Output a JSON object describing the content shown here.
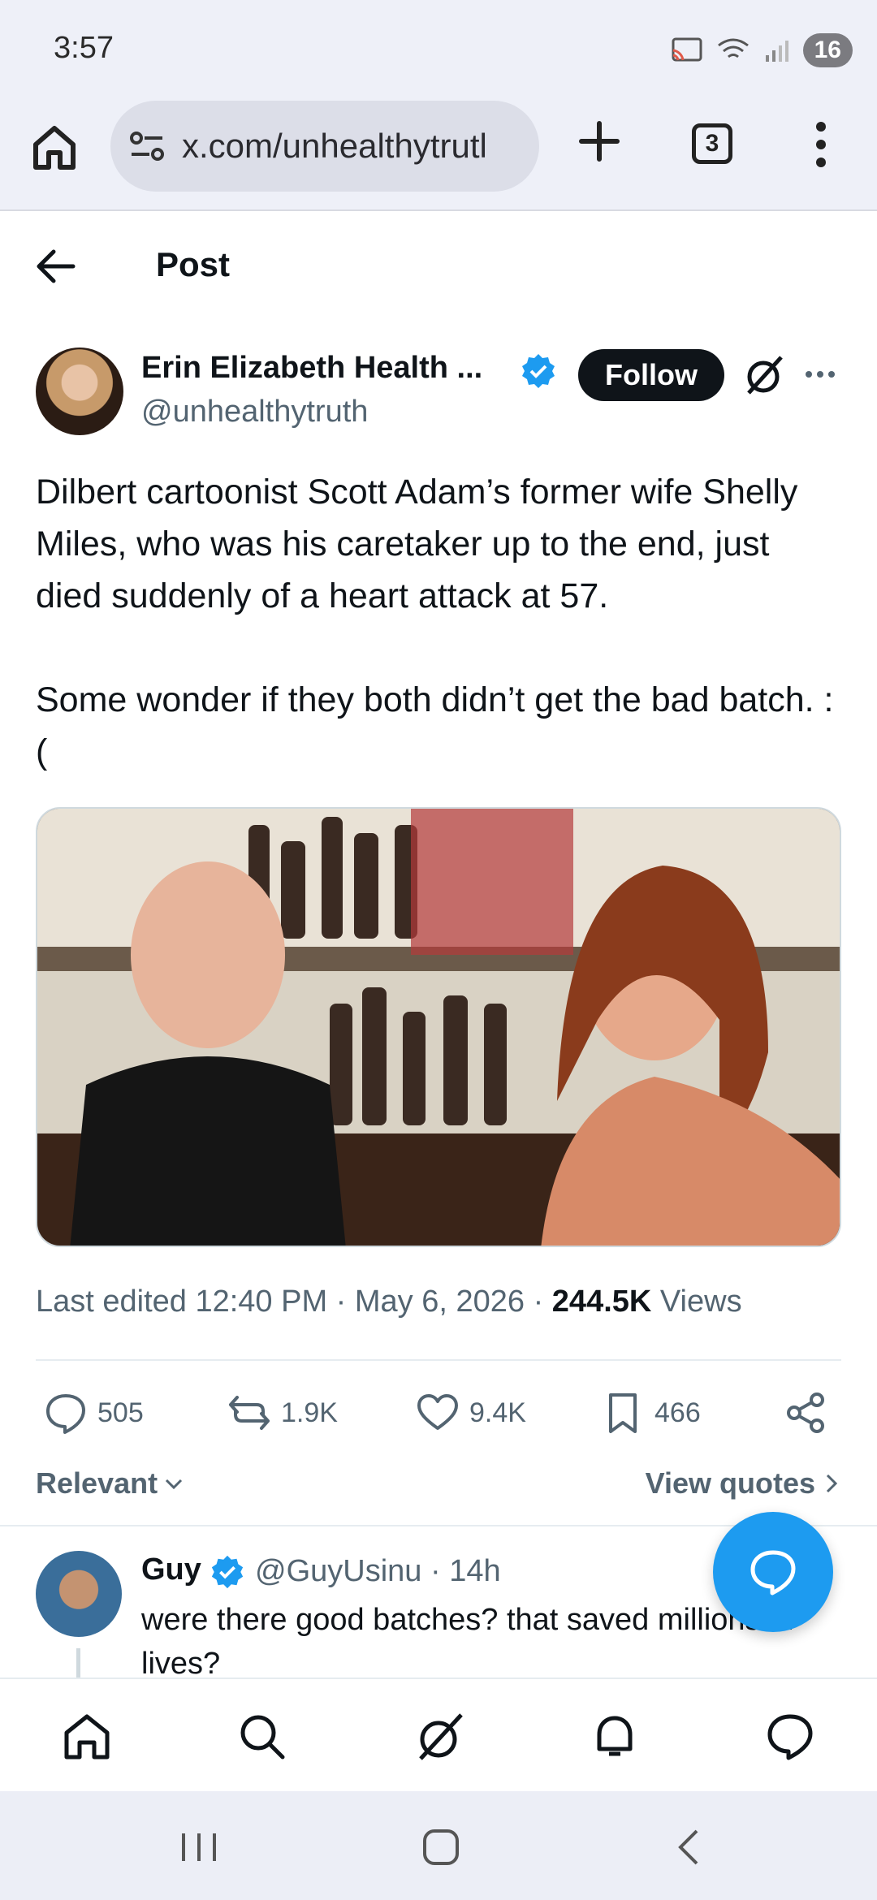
{
  "status": {
    "time": "3:57",
    "battery": "16"
  },
  "browser": {
    "url": "x.com/unhealthytrutl",
    "tab_count": "3"
  },
  "header": {
    "title": "Post"
  },
  "post": {
    "author_name": "Erin Elizabeth Health ...",
    "handle": "@unhealthytruth",
    "follow_label": "Follow",
    "text": "Dilbert cartoonist Scott Adam’s  former wife Shelly Miles, who was his caretaker up to the end, just died suddenly of a heart attack at 57.\n\nSome wonder if they both didn’t get the bad batch. :(",
    "meta": {
      "edited": "Last edited 12:40 PM · May 6, 2026 · ",
      "views_count": "244.5K",
      "views_label": " Views"
    },
    "actions": {
      "replies": "505",
      "reposts": "1.9K",
      "likes": "9.4K",
      "bookmarks": "466"
    }
  },
  "filters": {
    "sort_label": "Relevant",
    "quotes_label": "View quotes"
  },
  "reply": {
    "name": "Guy",
    "handle_time": "@GuyUsinu · 14h",
    "text": "were there good batches? that saved millions of lives?"
  },
  "colors": {
    "accent": "#1d9bf0",
    "text": "#0f1419",
    "muted": "#536471"
  }
}
